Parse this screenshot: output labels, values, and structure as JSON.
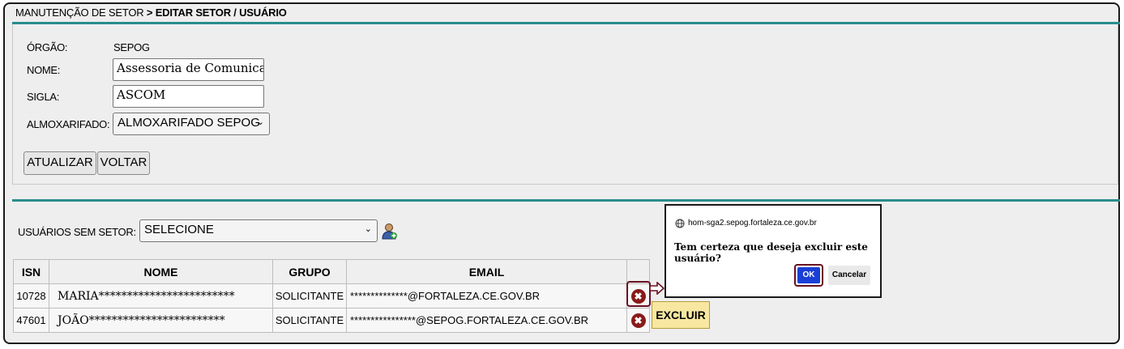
{
  "breadcrumb": {
    "section": "MANUTENÇÃO DE SETOR",
    "separator": " > ",
    "current": "EDITAR SETOR / USUÁRIO"
  },
  "form": {
    "orgao_label": "ÓRGÃO:",
    "orgao_value": "SEPOG",
    "nome_label": "NOME:",
    "nome_value": "Assessoria de Comunicação",
    "sigla_label": "SIGLA:",
    "sigla_value": "ASCOM",
    "almox_label": "ALMOXARIFADO:",
    "almox_selected": "ALMOXARIFADO SEPOG"
  },
  "buttons": {
    "update": "ATUALIZAR",
    "back": "VOLTAR"
  },
  "unassigned": {
    "label": "USUÁRIOS SEM SETOR:",
    "selected": "SELECIONE",
    "add_icon": "add-user-icon"
  },
  "table": {
    "headers": [
      "ISN",
      "NOME",
      "GRUPO",
      "EMAIL",
      ""
    ],
    "rows": [
      {
        "isn": "10728",
        "nome": "MARIA************************",
        "grupo": "SOLICITANTE",
        "email": "**************@FORTALEZA.CE.GOV.BR"
      },
      {
        "isn": "47601",
        "nome": "JOÃO************************",
        "grupo": "SOLICITANTE",
        "email": "****************@SEPOG.FORTALEZA.CE.GOV.BR"
      }
    ],
    "delete_icon": "delete-icon"
  },
  "tooltip": {
    "text": "EXCLUIR"
  },
  "dialog": {
    "origin": "hom-sga2.sepog.fortaleza.ce.gov.br",
    "message": "Tem certeza que deseja excluir este usuário?",
    "ok": "OK",
    "cancel": "Cancelar"
  },
  "colors": {
    "accent_rule": "#2a8c8c",
    "highlight": "#6a1020",
    "ok_button": "#1a3fd6",
    "tooltip_bg": "#f7e7a1"
  }
}
